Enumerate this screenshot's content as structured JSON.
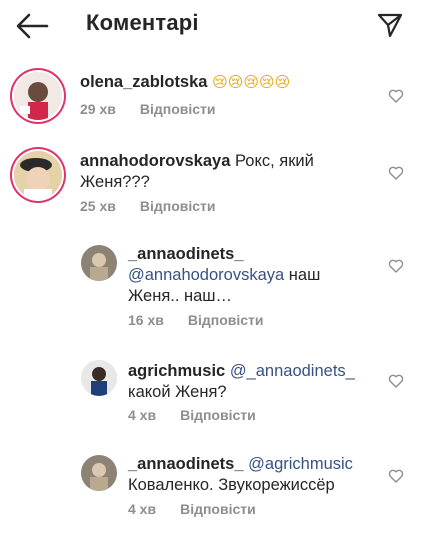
{
  "header": {
    "title": "Коментарі"
  },
  "comments": [
    {
      "username": "olena_zablotska",
      "text": "",
      "emoji": "😢😢😢😢😢",
      "time": "29 хв",
      "reply_label": "Відповісти"
    },
    {
      "username": "annahodorovskaya",
      "text": "Рокс, який Женя???",
      "time": "25 хв",
      "reply_label": "Відповісти"
    }
  ],
  "replies": [
    {
      "username": "_annaodinets_",
      "mention": "@annahodorovskaya",
      "text": "наш Женя.. наш…",
      "time": "16 хв",
      "reply_label": "Відповісти"
    },
    {
      "username": "agrichmusic",
      "mention": "@_annaodinets_",
      "text": "какой Женя?",
      "time": "4 хв",
      "reply_label": "Відповісти"
    },
    {
      "username": "_annaodinets_",
      "mention": "@agrichmusic",
      "text": "Коваленко. Звукорежиссёр",
      "time": "4 хв",
      "reply_label": "Відповісти"
    }
  ]
}
